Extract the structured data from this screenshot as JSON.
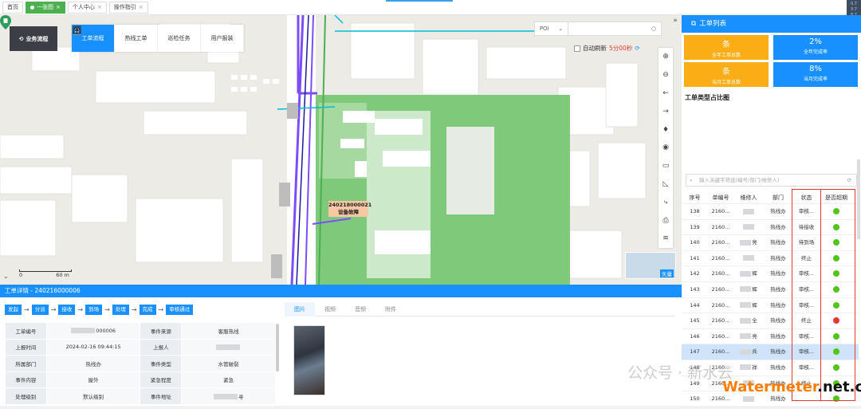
{
  "tabs": [
    {
      "label": "首页",
      "active": false,
      "closable": false
    },
    {
      "label": "一张图",
      "active": true,
      "closable": true
    },
    {
      "label": "个人中心",
      "active": false,
      "closable": true
    },
    {
      "label": "操作指引",
      "active": false,
      "closable": true
    }
  ],
  "logo": {
    "label": "业务流程"
  },
  "topnav": [
    {
      "label": "工单流程",
      "icon": "clipboard-icon",
      "active": true
    },
    {
      "label": "热线工单",
      "icon": "headset-icon",
      "active": false
    },
    {
      "label": "巡检任务",
      "icon": "map-pin-icon",
      "active": false
    },
    {
      "label": "用户报装",
      "icon": "form-icon",
      "active": false
    }
  ],
  "search": {
    "type": "POI",
    "placeholder": ""
  },
  "refresh": {
    "label": "自动刷新",
    "countdown": "5分00秒"
  },
  "map": {
    "marker_id": "240218000021",
    "marker_type": "设备故障",
    "scale_start": "0",
    "scale_end": "60 m",
    "minimap_label": "矢量"
  },
  "detail": {
    "title": "工单详情 - 240216000006",
    "flow": [
      "发起",
      "分派",
      "接收",
      "到场",
      "处理",
      "完成",
      "审核通过"
    ],
    "fields": [
      {
        "k1": "工单编号",
        "v1": "000006",
        "v1_blurred": true,
        "k2": "事件来源",
        "v2": "客服热线"
      },
      {
        "k1": "上报时间",
        "v1": "2024-02-16 09:44:15",
        "k2": "上报人",
        "v2": "",
        "v2_blurred": true
      },
      {
        "k1": "所属部门",
        "v1": "热线办",
        "k2": "事件类型",
        "v2": "水管破裂"
      },
      {
        "k1": "事件内容",
        "v1": "屋外",
        "k2": "紧急程度",
        "v2": "紧急"
      },
      {
        "k1": "处理级别",
        "v1": "默认级别",
        "k2": "事件地址",
        "v2": "寻",
        "v2_blurred": true
      }
    ],
    "media_tabs": [
      "图片",
      "视频",
      "音频",
      "附件"
    ]
  },
  "panel": {
    "title": "工单列表",
    "stats": [
      {
        "value": "条",
        "label": "全年工单总数",
        "color": "#faad14"
      },
      {
        "value": "2%",
        "label": "全年完成率",
        "color": "#1890ff"
      },
      {
        "value": "条",
        "label": "当月工单总数",
        "color": "#faad14"
      },
      {
        "value": "8%",
        "label": "当月完成率",
        "color": "#1890ff"
      }
    ],
    "pie_title": "工单类型占比图",
    "search_placeholder": "输入关键字筛选(编号/部门/维修人)",
    "columns": [
      "序号",
      "单编号",
      "维修人",
      "部门",
      "状态",
      "是否超期"
    ],
    "rows": [
      {
        "no": "138",
        "id": "2160...",
        "person": "",
        "dept": "热线办",
        "status": "审核...",
        "light": "green"
      },
      {
        "no": "139",
        "id": "2160...",
        "person": "",
        "dept": "热线办",
        "status": "待接收",
        "light": "green"
      },
      {
        "no": "140",
        "id": "2160...",
        "person": "亮",
        "dept": "热线办",
        "status": "待到场",
        "light": "green"
      },
      {
        "no": "141",
        "id": "2160...",
        "person": "",
        "dept": "热线办",
        "status": "终止",
        "light": "green"
      },
      {
        "no": "142",
        "id": "2160...",
        "person": "辉",
        "dept": "热线办",
        "status": "审核...",
        "light": "green"
      },
      {
        "no": "143",
        "id": "2160...",
        "person": "辉",
        "dept": "热线办",
        "status": "审核...",
        "light": "green"
      },
      {
        "no": "144",
        "id": "2160...",
        "person": "辉",
        "dept": "热线办",
        "status": "审核...",
        "light": "green"
      },
      {
        "no": "145",
        "id": "2160...",
        "person": "全",
        "dept": "热线办",
        "status": "终止",
        "light": "red"
      },
      {
        "no": "146",
        "id": "2160...",
        "person": "亮",
        "dept": "热线办",
        "status": "审核...",
        "light": "green"
      },
      {
        "no": "147",
        "id": "2160...",
        "person": "兵",
        "dept": "热线办",
        "status": "审核...",
        "light": "green",
        "selected": true
      },
      {
        "no": "148",
        "id": "2160...",
        "person": "祥",
        "dept": "热线办",
        "status": "审核...",
        "light": "green"
      },
      {
        "no": "149",
        "id": "2160...",
        "person": "",
        "dept": "热线办",
        "status": "终止",
        "light": "green"
      },
      {
        "no": "150",
        "id": "2160...",
        "person": "",
        "dept": "热线办",
        "status": "",
        "light": "green"
      }
    ]
  },
  "watermark": {
    "text": "公众号 · 新水云",
    "brand_a": "Watermeter",
    "brand_b": ".net.cn"
  },
  "colors": {
    "primary": "#1890ff",
    "stat_orange": "#faad14",
    "tab_green": "#4caf50",
    "alert_red": "#e53935",
    "ok_green": "#52c41a"
  }
}
